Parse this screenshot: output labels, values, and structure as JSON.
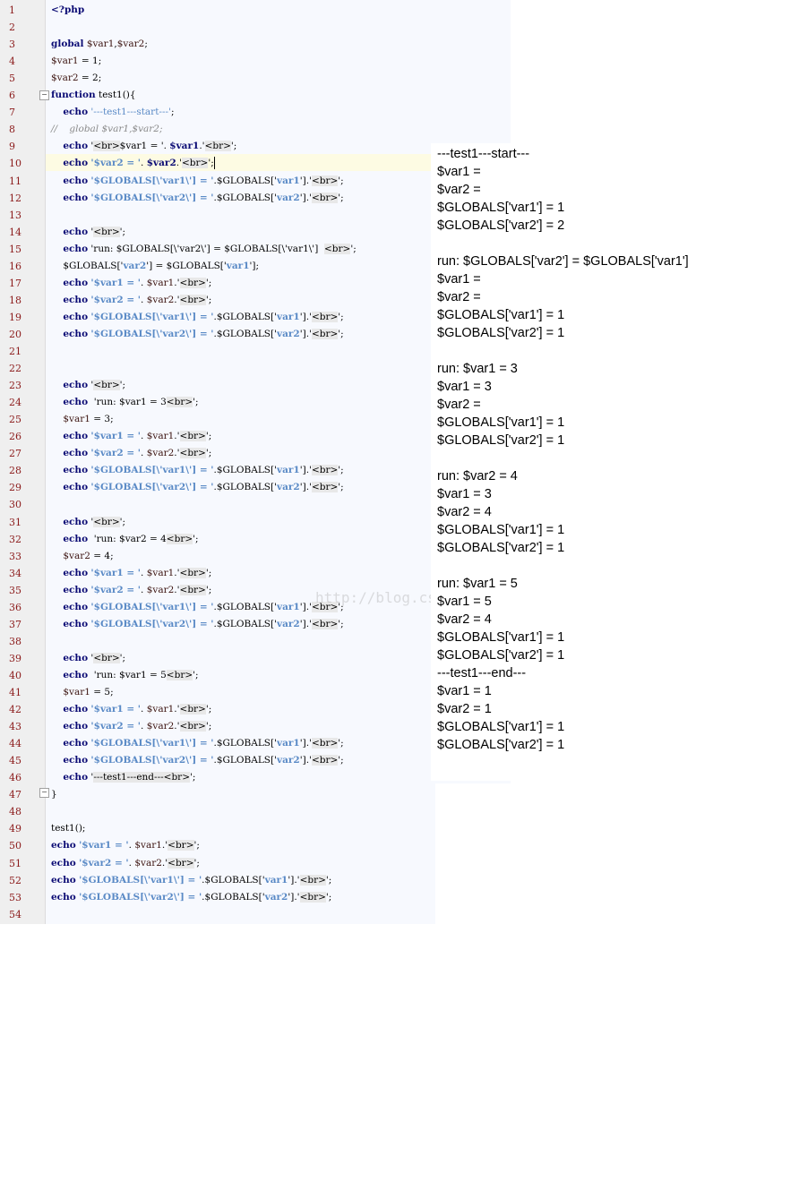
{
  "editor": {
    "lines": [
      {
        "n": "1",
        "html": "<span class='kw'>&lt;?php</span>"
      },
      {
        "n": "2",
        "html": ""
      },
      {
        "n": "3",
        "html": "<span class='kw'>global</span> <span class='var'>$var1</span>,<span class='var'>$var2</span>;"
      },
      {
        "n": "4",
        "html": "<span class='var'>$var1</span> = 1;"
      },
      {
        "n": "5",
        "html": "<span class='var'>$var2</span> = 2;"
      },
      {
        "n": "6",
        "html": "<span class='kw'>function</span> test1(){"
      },
      {
        "n": "7",
        "html": "    <span class='kw'>echo</span> <span class='strn'>'---test1---start---'</span>;"
      },
      {
        "n": "8",
        "html": "<span class='cmt'>//    global $var1,$var2;</span>"
      },
      {
        "n": "9",
        "html": "    <span class='kw'>echo</span> '<span class='tag'>&lt;br&gt;</span>$var1 = '. <span class='kw'>$var1</span>.'<span class='tag'>&lt;br&gt;</span>';"
      },
      {
        "n": "10",
        "html": "    <span class='kw'>echo</span> <span class='str'>'$var2 = '</span>. <span class='kw'>$var2</span>.'<span class='tag'>&lt;br&gt;</span>';<span class='caret'></span>"
      },
      {
        "n": "11",
        "html": "    <span class='kw'>echo</span> <span class='str'>'$GLOBALS[\\'var1\\'] = '</span>.$GLOBALS['<span class='str'>var1</span>'].'<span class='tag'>&lt;br&gt;</span>';"
      },
      {
        "n": "12",
        "html": "    <span class='kw'>echo</span> <span class='str'>'$GLOBALS[\\'var2\\'] = '</span>.$GLOBALS['<span class='str'>var2</span>'].'<span class='tag'>&lt;br&gt;</span>';"
      },
      {
        "n": "13",
        "html": ""
      },
      {
        "n": "14",
        "html": "    <span class='kw'>echo</span> '<span class='tag'>&lt;br&gt;</span>';"
      },
      {
        "n": "15",
        "html": "    <span class='kw'>echo</span> 'run: $GLOBALS[\\'var2\\'] = $GLOBALS[\\'var1\\']  <span class='tag'>&lt;br&gt;</span>';"
      },
      {
        "n": "16",
        "html": "    $GLOBALS['<span class='str'>var2</span>'] = $GLOBALS['<span class='str'>var1</span>'];"
      },
      {
        "n": "17",
        "html": "    <span class='kw'>echo</span> <span class='str'>'$var1 = '</span>. <span class='var'>$var1</span>.'<span class='tag'>&lt;br&gt;</span>';"
      },
      {
        "n": "18",
        "html": "    <span class='kw'>echo</span> <span class='str'>'$var2 = '</span>. <span class='var'>$var2</span>.'<span class='tag'>&lt;br&gt;</span>';"
      },
      {
        "n": "19",
        "html": "    <span class='kw'>echo</span> <span class='str'>'$GLOBALS[\\'var1\\'] = '</span>.$GLOBALS['<span class='str'>var1</span>'].'<span class='tag'>&lt;br&gt;</span>';"
      },
      {
        "n": "20",
        "html": "    <span class='kw'>echo</span> <span class='str'>'$GLOBALS[\\'var2\\'] = '</span>.$GLOBALS['<span class='str'>var2</span>'].'<span class='tag'>&lt;br&gt;</span>';"
      },
      {
        "n": "21",
        "html": ""
      },
      {
        "n": "22",
        "html": ""
      },
      {
        "n": "23",
        "html": "    <span class='kw'>echo</span> '<span class='tag'>&lt;br&gt;</span>';"
      },
      {
        "n": "24",
        "html": "    <span class='kw'>echo</span>  'run: $var1 = 3<span class='tag'>&lt;br&gt;</span>';"
      },
      {
        "n": "25",
        "html": "    <span class='var'>$var1</span> = 3;"
      },
      {
        "n": "26",
        "html": "    <span class='kw'>echo</span> <span class='str'>'$var1 = '</span>. <span class='var'>$var1</span>.'<span class='tag'>&lt;br&gt;</span>';"
      },
      {
        "n": "27",
        "html": "    <span class='kw'>echo</span> <span class='str'>'$var2 = '</span>. <span class='var'>$var2</span>.'<span class='tag'>&lt;br&gt;</span>';"
      },
      {
        "n": "28",
        "html": "    <span class='kw'>echo</span> <span class='str'>'$GLOBALS[\\'var1\\'] = '</span>.$GLOBALS['<span class='str'>var1</span>'].'<span class='tag'>&lt;br&gt;</span>';"
      },
      {
        "n": "29",
        "html": "    <span class='kw'>echo</span> <span class='str'>'$GLOBALS[\\'var2\\'] = '</span>.$GLOBALS['<span class='str'>var2</span>'].'<span class='tag'>&lt;br&gt;</span>';"
      },
      {
        "n": "30",
        "html": ""
      },
      {
        "n": "31",
        "html": "    <span class='kw'>echo</span> '<span class='tag'>&lt;br&gt;</span>';"
      },
      {
        "n": "32",
        "html": "    <span class='kw'>echo</span>  'run: $var2 = 4<span class='tag'>&lt;br&gt;</span>';"
      },
      {
        "n": "33",
        "html": "    <span class='var'>$var2</span> = 4;"
      },
      {
        "n": "34",
        "html": "    <span class='kw'>echo</span> <span class='str'>'$var1 = '</span>. <span class='var'>$var1</span>.'<span class='tag'>&lt;br&gt;</span>';"
      },
      {
        "n": "35",
        "html": "    <span class='kw'>echo</span> <span class='str'>'$var2 = '</span>. <span class='var'>$var2</span>.'<span class='tag'>&lt;br&gt;</span>';"
      },
      {
        "n": "36",
        "html": "    <span class='kw'>echo</span> <span class='str'>'$GLOBALS[\\'var1\\'] = '</span>.$GLOBALS['<span class='str'>var1</span>'].'<span class='tag'>&lt;br&gt;</span>';"
      },
      {
        "n": "37",
        "html": "    <span class='kw'>echo</span> <span class='str'>'$GLOBALS[\\'var2\\'] = '</span>.$GLOBALS['<span class='str'>var2</span>'].'<span class='tag'>&lt;br&gt;</span>';"
      },
      {
        "n": "38",
        "html": ""
      },
      {
        "n": "39",
        "html": "    <span class='kw'>echo</span> '<span class='tag'>&lt;br&gt;</span>';"
      },
      {
        "n": "40",
        "html": "    <span class='kw'>echo</span>  'run: $var1 = 5<span class='tag'>&lt;br&gt;</span>';"
      },
      {
        "n": "41",
        "html": "    <span class='var'>$var1</span> = 5;"
      },
      {
        "n": "42",
        "html": "    <span class='kw'>echo</span> <span class='str'>'$var1 = '</span>. <span class='var'>$var1</span>.'<span class='tag'>&lt;br&gt;</span>';"
      },
      {
        "n": "43",
        "html": "    <span class='kw'>echo</span> <span class='str'>'$var2 = '</span>. <span class='var'>$var2</span>.'<span class='tag'>&lt;br&gt;</span>';"
      },
      {
        "n": "44",
        "html": "    <span class='kw'>echo</span> <span class='str'>'$GLOBALS[\\'var1\\'] = '</span>.$GLOBALS['<span class='str'>var1</span>'].'<span class='tag'>&lt;br&gt;</span>';"
      },
      {
        "n": "45",
        "html": "    <span class='kw'>echo</span> <span class='str'>'$GLOBALS[\\'var2\\'] = '</span>.$GLOBALS['<span class='str'>var2</span>'].'<span class='tag'>&lt;br&gt;</span>';"
      },
      {
        "n": "46",
        "html": "    <span class='kw'>echo</span> '<span class='tag'>---test1---end---&lt;br&gt;</span>';"
      },
      {
        "n": "47",
        "html": "}"
      },
      {
        "n": "48",
        "html": ""
      },
      {
        "n": "49",
        "html": "test1();"
      },
      {
        "n": "50",
        "html": "<span class='kw'>echo</span> <span class='str'>'$var1 = '</span>. <span class='var'>$var1</span>.'<span class='tag'>&lt;br&gt;</span>';"
      },
      {
        "n": "51",
        "html": "<span class='kw'>echo</span> <span class='str'>'$var2 = '</span>. <span class='var'>$var2</span>.'<span class='tag'>&lt;br&gt;</span>';"
      },
      {
        "n": "52",
        "html": "<span class='kw'>echo</span> <span class='str'>'$GLOBALS[\\'var1\\'] = '</span>.$GLOBALS['<span class='str'>var1</span>'].'<span class='tag'>&lt;br&gt;</span>';"
      },
      {
        "n": "53",
        "html": "<span class='kw'>echo</span> <span class='str'>'$GLOBALS[\\'var2\\'] = '</span>.$GLOBALS['<span class='str'>var2</span>'].'<span class='tag'>&lt;br&gt;</span>';"
      },
      {
        "n": "54",
        "html": ""
      }
    ]
  },
  "output": {
    "lines": [
      "---test1---start---",
      "$var1 =",
      "$var2 =",
      "$GLOBALS['var1'] = 1",
      "$GLOBALS['var2'] = 2",
      "",
      "run: $GLOBALS['var2'] = $GLOBALS['var1']",
      "$var1 =",
      "$var2 =",
      "$GLOBALS['var1'] = 1",
      "$GLOBALS['var2'] = 1",
      "",
      "run: $var1 = 3",
      "$var1 = 3",
      "$var2 =",
      "$GLOBALS['var1'] = 1",
      "$GLOBALS['var2'] = 1",
      "",
      "run: $var2 = 4",
      "$var1 = 3",
      "$var2 = 4",
      "$GLOBALS['var1'] = 1",
      "$GLOBALS['var2'] = 1",
      "",
      "run: $var1 = 5",
      "$var1 = 5",
      "$var2 = 4",
      "$GLOBALS['var1'] = 1",
      "$GLOBALS['var2'] = 1",
      "---test1---end---",
      "$var1 = 1",
      "$var2 = 1",
      "$GLOBALS['var1'] = 1",
      "$GLOBALS['var2'] = 1"
    ]
  },
  "watermark": "http://blog.csdn.net/"
}
